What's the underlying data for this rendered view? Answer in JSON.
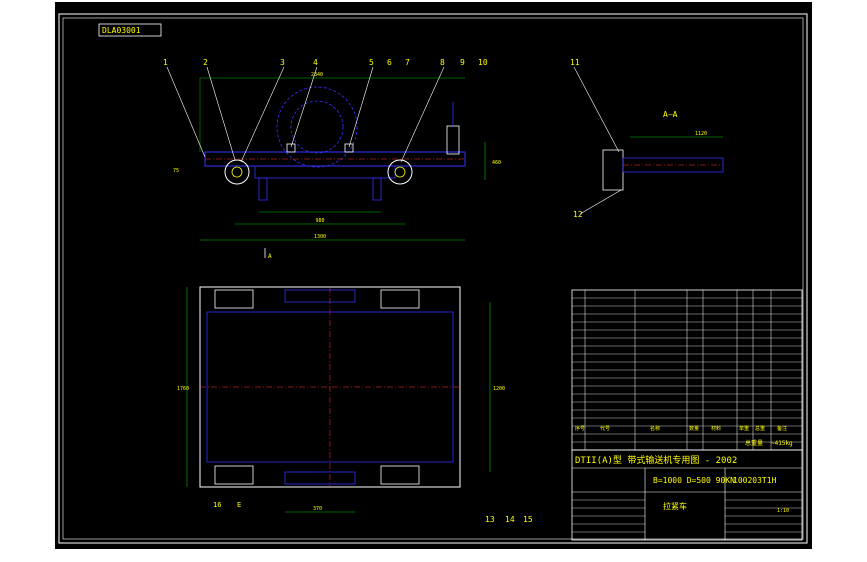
{
  "drawing": {
    "code_box": "DLA03001",
    "section_label": "A—A",
    "section_mark": "A",
    "callouts_top": [
      "1",
      "2",
      "3",
      "4",
      "5",
      "6",
      "7",
      "8",
      "9",
      "10",
      "11",
      "12"
    ],
    "callouts_bottom": [
      "13",
      "14",
      "15",
      "16"
    ],
    "callout_e": "E",
    "dims": {
      "top_overall": "2340",
      "bottom_span": "1300",
      "inner_span": "980",
      "height_right": "460",
      "small_left": "75",
      "section_width": "1120",
      "plan_height": "1760",
      "plan_side": "1200",
      "plan_bottom": "370"
    }
  },
  "title_block": {
    "title_line": "DTII(A)型 带式输送机专用图 - 2002",
    "spec": "B=1000 D=500 90KN",
    "drawing_no": "100203T1H",
    "part_name": "拉紧车",
    "weight_label": "总重量",
    "weight_value": "~415kg",
    "ratio": "1:10",
    "header": [
      "序号",
      "代号",
      "名称",
      "数量",
      "材料",
      "单重",
      "总重",
      "备注"
    ]
  },
  "colors": {
    "background": "#000000",
    "outline": "#ffffff",
    "geometry": "#3333ff",
    "dimension": "#00c000",
    "text_yellow": "#ffff00",
    "text_magenta": "#ff33ff",
    "hidden": "#ff3333",
    "leader": "#00ffff"
  }
}
